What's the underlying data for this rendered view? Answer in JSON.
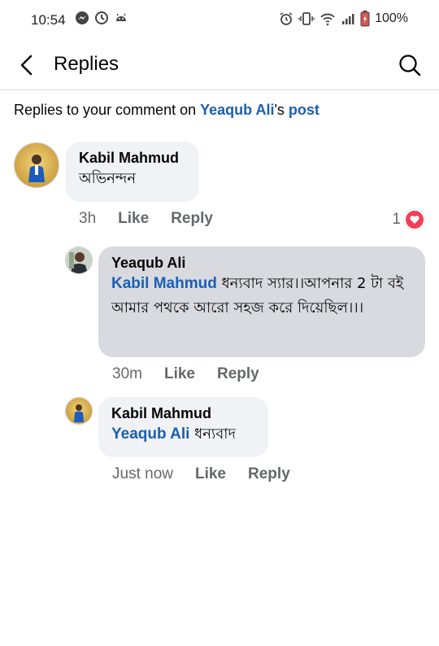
{
  "status_bar": {
    "time": "10:54",
    "battery": "100%",
    "left_icons": [
      "messenger-icon",
      "clock-icon",
      "android-icon"
    ],
    "right_icons": [
      "alarm-icon",
      "vibrate-icon",
      "wifi-icon",
      "signal-icon",
      "battery-icon"
    ]
  },
  "header": {
    "title": "Replies",
    "back_icon": "arrow-left-icon",
    "search_icon": "search-icon"
  },
  "context": {
    "prefix": "Replies to your comment on ",
    "name": "Yeaqub Ali",
    "possessive": "'s ",
    "post_link": "post"
  },
  "comments": [
    {
      "author": "Kabil Mahmud",
      "text": "অভিনন্দন",
      "time": "3h",
      "like": "Like",
      "reply": "Reply",
      "reaction_count": "1",
      "reaction_icon": "heart-icon"
    },
    {
      "author": "Yeaqub Ali",
      "mention": "Kabil Mahmud",
      "text": " ধন্যবাদ স্যার।।আপনার 2 টা বই আমার পথকে আরো সহজ করে দিয়েছিল।।।",
      "time": "30m",
      "like": "Like",
      "reply": "Reply"
    },
    {
      "author": "Kabil Mahmud",
      "mention": "Yeaqub Ali",
      "text": " ধন্যবাদ",
      "time": "Just now",
      "like": "Like",
      "reply": "Reply"
    }
  ],
  "colors": {
    "link": "#1a5fb4",
    "bubble": "#f0f2f5",
    "bubble_highlight": "#d8dadf",
    "meta": "#65676b",
    "heart": "#f33e58"
  }
}
